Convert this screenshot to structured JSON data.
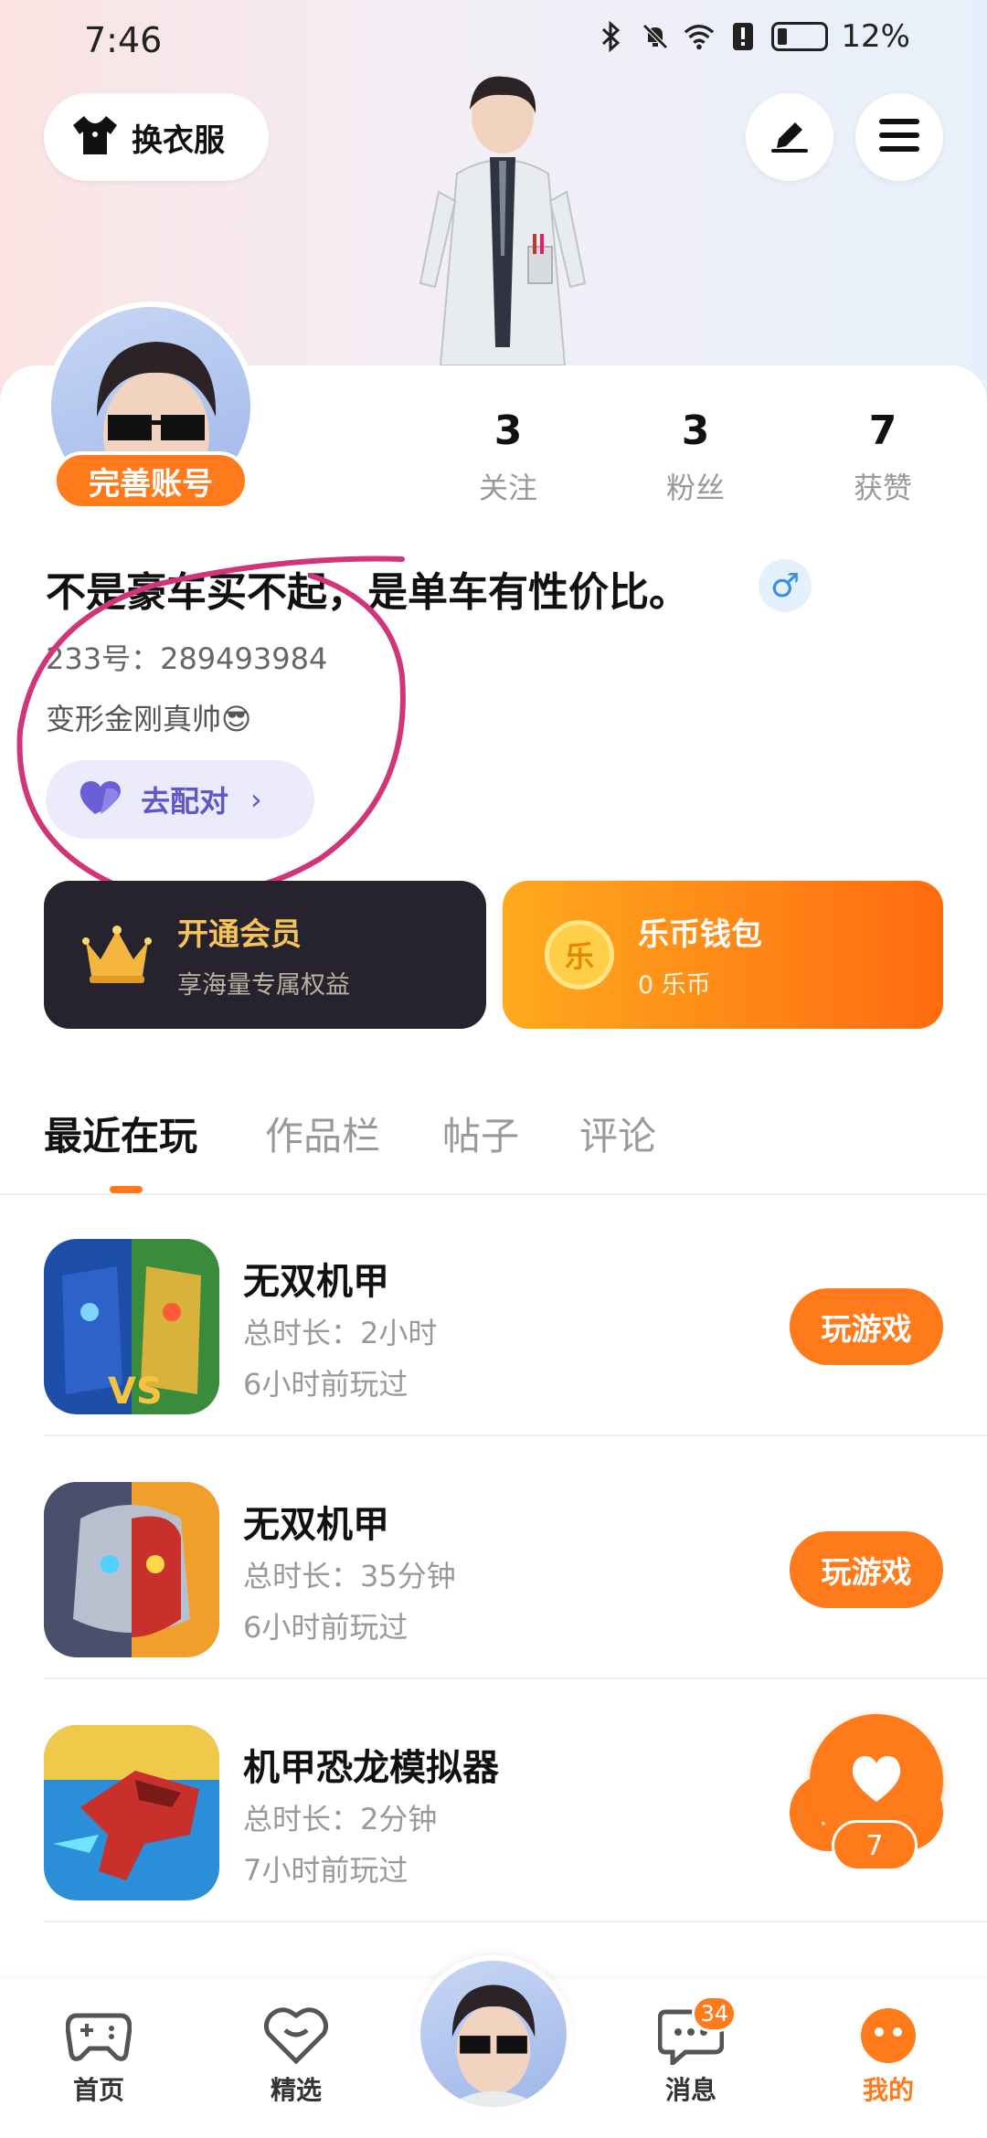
{
  "status_bar": {
    "time": "7:46",
    "battery": "12%"
  },
  "header": {
    "outfit_label": "换衣服"
  },
  "profile": {
    "complete_badge": "完善账号",
    "stats": [
      {
        "num": "3",
        "label": "关注"
      },
      {
        "num": "3",
        "label": "粉丝"
      },
      {
        "num": "7",
        "label": "获赞"
      }
    ],
    "nickname": "不是豪车买不起，是单车有性价比。",
    "gender": "♂",
    "uid": "233号：289493984",
    "bio": "变形金刚真帅😎",
    "match_label": "去配对",
    "match_chevron": "›"
  },
  "cards": {
    "vip": {
      "title": "开通会员",
      "subtitle": "享海量专属权益"
    },
    "wallet": {
      "icon_text": "乐",
      "title": "乐币钱包",
      "subtitle": "0 乐币"
    }
  },
  "tabs": [
    "最近在玩",
    "作品栏",
    "帖子",
    "评论"
  ],
  "games": [
    {
      "title": "无双机甲",
      "duration": "总时长：2小时",
      "last_played": "6小时前玩过",
      "button": "玩游戏"
    },
    {
      "title": "无双机甲",
      "duration": "总时长：35分钟",
      "last_played": "6小时前玩过",
      "button": "玩游戏"
    },
    {
      "title": "机甲恐龙模拟器",
      "duration": "总时长：2分钟",
      "last_played": "7小时前玩过",
      "button": "玩游戏"
    }
  ],
  "fab": {
    "count": "7"
  },
  "bottom_nav": {
    "items": [
      {
        "label": "首页"
      },
      {
        "label": "精选"
      },
      {
        "label": "消息",
        "badge": "34"
      },
      {
        "label": "我的"
      }
    ]
  },
  "colors": {
    "accent": "#ff7a1a",
    "vip_bg": "#26232f",
    "annotation": "#d0357a"
  }
}
